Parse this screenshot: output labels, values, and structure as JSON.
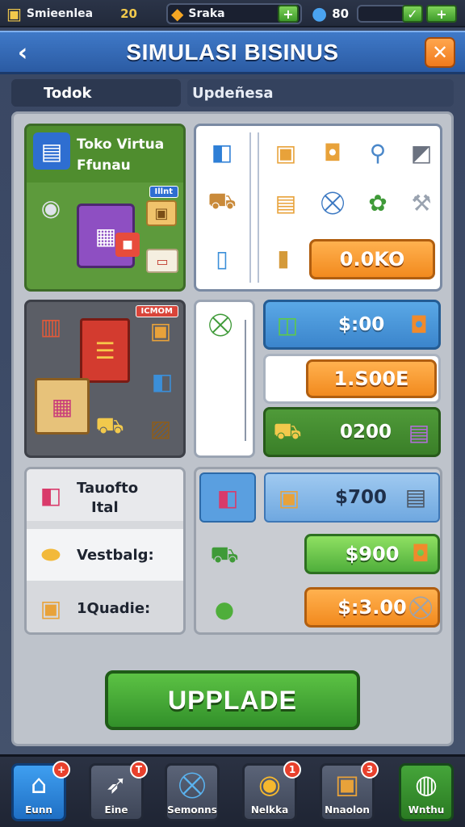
{
  "topbar": {
    "res1": {
      "label": "Smieenlea",
      "value": "20",
      "icon": "cube-icon"
    },
    "res2": {
      "label": "Sraka",
      "icon": "gold-cube-icon",
      "plus": "+"
    },
    "res3": {
      "value": "80",
      "icon": "blue-gem-icon",
      "plus": "+"
    }
  },
  "header": {
    "title": "SIMULASI BISINUS",
    "back": "‹",
    "close": "✕"
  },
  "tabs": [
    {
      "label": "Todok"
    },
    {
      "label": "Updeñesa"
    }
  ],
  "panels": {
    "shop": {
      "title_line1": "Toko Virtua",
      "title_line2": "Ffunau",
      "tag": "Illnt"
    },
    "catalog": {
      "button_label": "0.0KO"
    },
    "storage": {
      "tag": "ICMOM"
    },
    "rows": [
      {
        "price": "$:00"
      },
      {
        "price": "1.S00E"
      },
      {
        "price": "0200"
      }
    ],
    "stats": [
      {
        "label_line1": "Tauofto",
        "label_line2": "Ital"
      },
      {
        "label": "Vestbalg:"
      },
      {
        "label": "1Quadie:"
      }
    ],
    "offers": [
      {
        "price": "$700"
      },
      {
        "price": "$900"
      },
      {
        "price": "$:3.00"
      }
    ]
  },
  "upgrade_button": {
    "label": "UPPLADE"
  },
  "nav": [
    {
      "label": "Eunn",
      "badge": "+",
      "icon": "home-icon"
    },
    {
      "label": "Eine",
      "badge": "T",
      "icon": "rocket-icon"
    },
    {
      "label": "Semonns",
      "icon": "basket-icon"
    },
    {
      "label": "Nelkka",
      "badge": "1",
      "icon": "coin-icon"
    },
    {
      "label": "Nnaolon",
      "badge": "3",
      "icon": "box-icon"
    },
    {
      "label": "Wnthu",
      "icon": "globe-icon"
    }
  ],
  "colors": {
    "primary": "#3f79c8",
    "accent_orange": "#f28a1e",
    "accent_green": "#4fae3b"
  }
}
